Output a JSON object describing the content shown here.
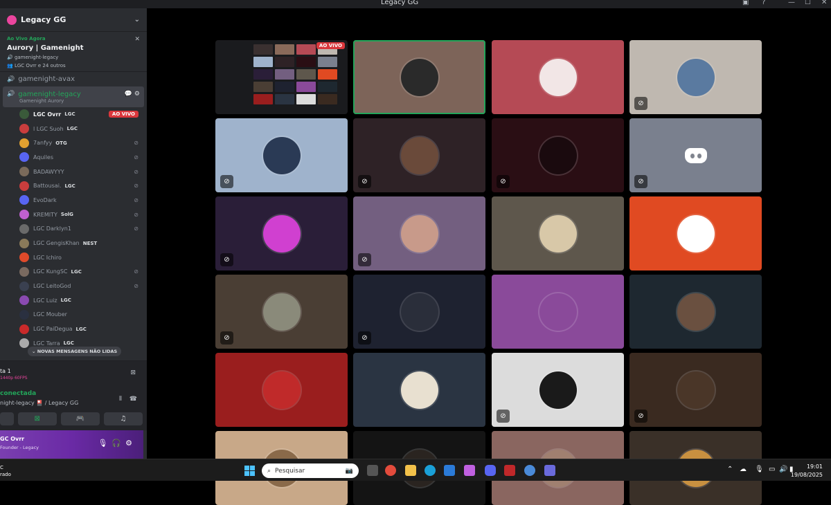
{
  "window": {
    "title": "Legacy GG"
  },
  "sidebar": {
    "server_name": "Legacy GG",
    "event": {
      "live_label": "Ao Vivo Agora",
      "name": "Aurory | Gamenight",
      "channel": "gamenight-legacy",
      "attendees": "LGC Ovrr e 24 outros"
    },
    "channels": [
      {
        "name": "gamenight-avax",
        "active": false
      },
      {
        "name": "gamenight-legacy",
        "active": true,
        "status": "Gamenight Aurory"
      }
    ],
    "members": [
      {
        "name": "LGC Ovrr",
        "tag": "LGC",
        "badge": "AO VIVO",
        "color": "#3a5a3a",
        "speaking": true
      },
      {
        "name": "l LGC Suoh",
        "tag": "LGC",
        "color": "#c93d3d"
      },
      {
        "name": "7anfyy",
        "tag": "OTG",
        "color": "#e0a030",
        "muted": true
      },
      {
        "name": "Aquiles",
        "tag": "",
        "color": "#5865f2",
        "muted": true
      },
      {
        "name": "BADAWYYY",
        "tag": "",
        "color": "#7a6a5a",
        "muted": true
      },
      {
        "name": "Battousai.",
        "tag": "LGC",
        "color": "#c93d3d",
        "muted": true
      },
      {
        "name": "EvoDark",
        "tag": "",
        "color": "#5865f2",
        "muted": true
      },
      {
        "name": "KREMITY",
        "tag": "SolG",
        "color": "#c060d0",
        "muted": true
      },
      {
        "name": "LGC Darklyn1",
        "tag": "",
        "color": "#6a6a6a",
        "muted": true
      },
      {
        "name": "LGC GengisKhan",
        "tag": "NEST",
        "color": "#8a7a5a"
      },
      {
        "name": "LGC Ichiro",
        "tag": "",
        "color": "#e04a2a"
      },
      {
        "name": "LGC KungSC",
        "tag": "LGC",
        "color": "#7a6a60",
        "muted": true
      },
      {
        "name": "LGC LeitoGod",
        "tag": "",
        "color": "#3a4050",
        "muted": true
      },
      {
        "name": "LGC Luiz",
        "tag": "LGC",
        "color": "#8a4ab0"
      },
      {
        "name": "LGC Mouber",
        "tag": "",
        "color": "#2a3040"
      },
      {
        "name": "LGC PaiDegua",
        "tag": "LGC",
        "color": "#c92a2a"
      },
      {
        "name": "LGC Tarra",
        "tag": "LGC",
        "color": "#aaa"
      }
    ],
    "new_messages": "NOVAS MENSAGENS NÃO LIDAS"
  },
  "voice": {
    "stream_title": "ta 1",
    "stream_res": "1440p 60FPS",
    "connected": "conectada",
    "channel_path": "night-legacy 🎴 / Legacy GG"
  },
  "user": {
    "name": "GC Ovrr",
    "title": "Founder - Legacy"
  },
  "stage": {
    "live_badge": "AO VIVO",
    "tiles": [
      {
        "type": "screen"
      },
      {
        "bg": "#7d6459",
        "av": "#2a2a2a",
        "selected": true
      },
      {
        "bg": "#b54a55",
        "av": "#f2e6e6"
      },
      {
        "bg": "#bfb8b0",
        "av": "#5a7aa0",
        "muted": true
      },
      {
        "bg": "#9fb3cc",
        "av": "#2a3a55",
        "muted": true
      },
      {
        "bg": "#2e2226",
        "av": "#6a4a3a",
        "muted": true
      },
      {
        "bg": "#2a0e14",
        "av": "#1a0a0e",
        "muted": true
      },
      {
        "bg": "#7a808e",
        "av": "discord",
        "muted": true
      },
      {
        "bg": "#2a1e38",
        "av": "#d040d0",
        "muted": true
      },
      {
        "bg": "#735f80",
        "av": "#c89a8a",
        "muted": true
      },
      {
        "bg": "#5e574c",
        "av": "#d8c8a8"
      },
      {
        "bg": "#e04a22",
        "av": "#ffffff"
      },
      {
        "bg": "#4a3e34",
        "av": "#8a8a7a",
        "muted": true
      },
      {
        "bg": "#1e2230",
        "av": "#2a2e3a",
        "muted": true
      },
      {
        "bg": "#8a4a9a",
        "av": "#8a4a9a"
      },
      {
        "bg": "#1e2830",
        "av": "#6a5040"
      },
      {
        "bg": "#9a1e1e",
        "av": "#c02a2a"
      },
      {
        "bg": "#2a3442",
        "av": "#e8e0d0"
      },
      {
        "bg": "#dcdcdc",
        "av": "#1a1a1a",
        "muted": true
      },
      {
        "bg": "#3a2a20",
        "av": "#4a3628",
        "muted": true
      },
      {
        "bg": "#c8a888",
        "av": "#8a6a4a"
      },
      {
        "bg": "#141414",
        "av": "#2a2420"
      },
      {
        "bg": "#8a6660",
        "av": "#a08070"
      },
      {
        "bg": "#3a3028",
        "av": "#c89040"
      }
    ]
  },
  "taskbar": {
    "search_placeholder": "Pesquisar",
    "time": "19:01",
    "date": "19/08/2025",
    "weather": "rado"
  }
}
